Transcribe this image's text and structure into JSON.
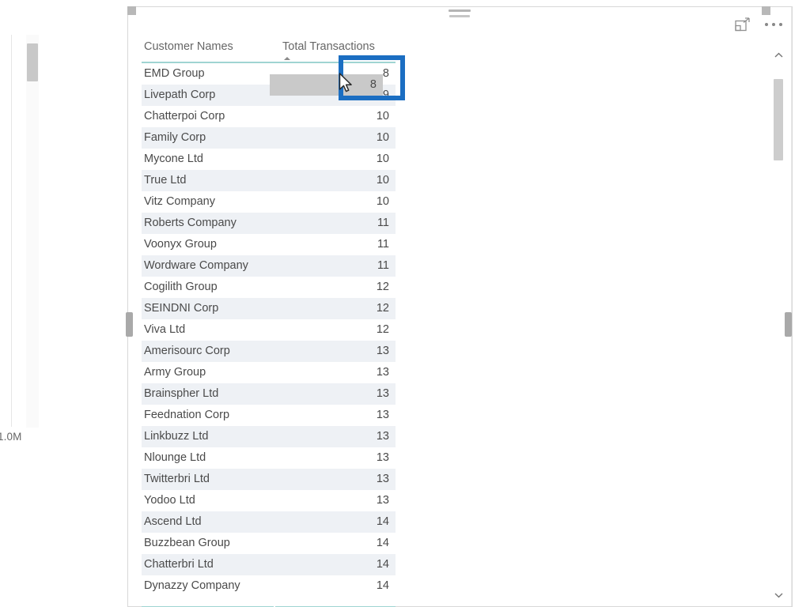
{
  "app": {
    "visual_type": "power-bi-table-visual"
  },
  "left_visual": {
    "axis_label": "1.0M",
    "scrollbar": "vertical-scrollbar"
  },
  "toolbar": {
    "focus_mode_label": "Focus mode",
    "more_options_label": "More options",
    "drag_handle_label": "Drag handle"
  },
  "table": {
    "columns": [
      {
        "key": "name",
        "label": "Customer Names",
        "sorted": false
      },
      {
        "key": "value",
        "label": "Total Transactions",
        "sorted": true,
        "sort_direction": "ascending"
      }
    ],
    "hovered_row": {
      "name": "EMD Group",
      "value": "8"
    },
    "rows": [
      {
        "name": "EMD Group",
        "value": "8"
      },
      {
        "name": "Livepath Corp",
        "value": "9"
      },
      {
        "name": "Chatterpoi Corp",
        "value": "10"
      },
      {
        "name": "Family Corp",
        "value": "10"
      },
      {
        "name": "Mycone Ltd",
        "value": "10"
      },
      {
        "name": "True Ltd",
        "value": "10"
      },
      {
        "name": "Vitz Company",
        "value": "10"
      },
      {
        "name": "Roberts Company",
        "value": "11"
      },
      {
        "name": "Voonyx Group",
        "value": "11"
      },
      {
        "name": "Wordware Company",
        "value": "11"
      },
      {
        "name": "Cogilith Group",
        "value": "12"
      },
      {
        "name": "SEINDNI Corp",
        "value": "12"
      },
      {
        "name": "Viva Ltd",
        "value": "12"
      },
      {
        "name": "Amerisourc Corp",
        "value": "13"
      },
      {
        "name": "Army Group",
        "value": "13"
      },
      {
        "name": "Brainspher Ltd",
        "value": "13"
      },
      {
        "name": "Feednation Corp",
        "value": "13"
      },
      {
        "name": "Linkbuzz Ltd",
        "value": "13"
      },
      {
        "name": "Nlounge Ltd",
        "value": "13"
      },
      {
        "name": "Twitterbri Ltd",
        "value": "13"
      },
      {
        "name": "Yodoo Ltd",
        "value": "13"
      },
      {
        "name": "Ascend Ltd",
        "value": "14"
      },
      {
        "name": "Buzzbean Group",
        "value": "14"
      },
      {
        "name": "Chatterbri Ltd",
        "value": "14"
      },
      {
        "name": "Dynazzy Company",
        "value": "14"
      }
    ]
  },
  "scrollbar": {
    "up_label": "Scroll up",
    "down_label": "Scroll down"
  },
  "annotation": {
    "color": "#1b6ec2",
    "target": "8"
  },
  "colors": {
    "accent_teal": "#9fd4d2",
    "alt_row": "#eef1f5",
    "hover_grey": "#c9c9c9",
    "text": "#4a4a4a",
    "header_text": "#666666",
    "annotation_blue": "#1b6ec2"
  }
}
